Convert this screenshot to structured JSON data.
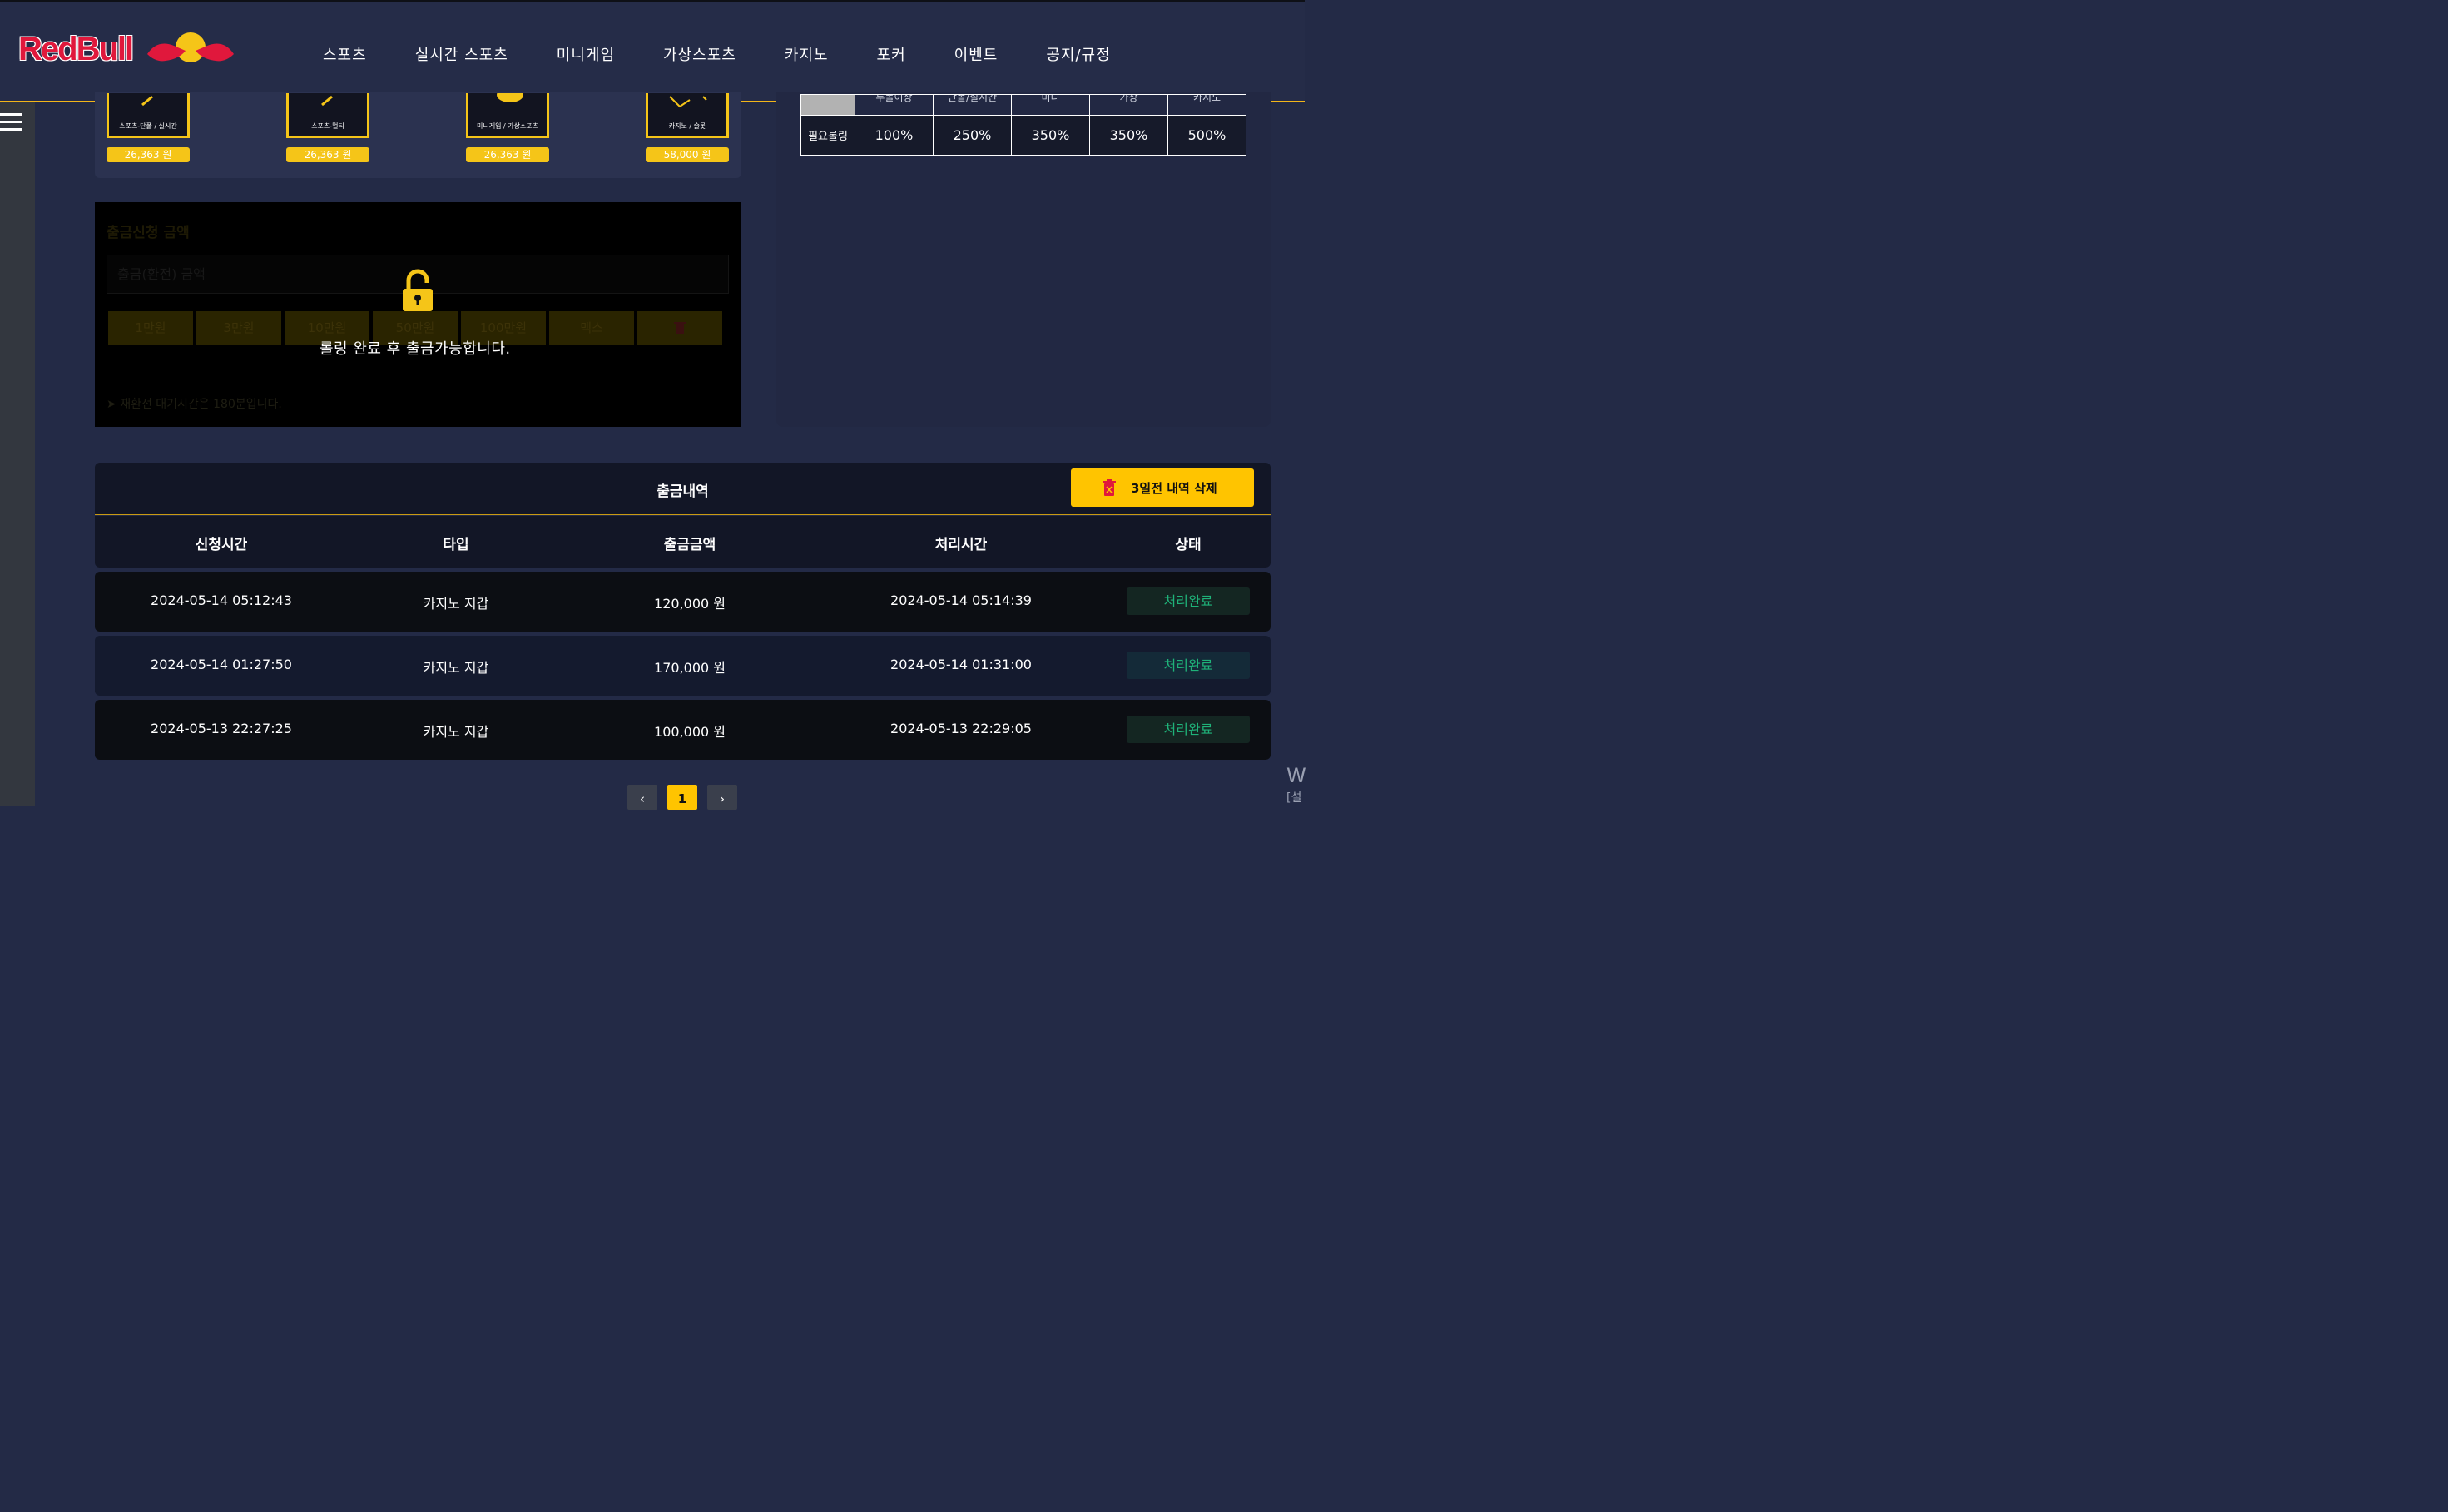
{
  "header": {
    "logo_text": "RedBull",
    "nav": [
      "스포츠",
      "실시간 스포츠",
      "미니게임",
      "가상스포츠",
      "카지노",
      "포커",
      "이벤트",
      "공지/규정"
    ]
  },
  "wallets": [
    {
      "label": "스포츠-단폴 / 실시간",
      "amount": "26,363 원"
    },
    {
      "label": "스포츠-멀티",
      "amount": "26,363 원"
    },
    {
      "label": "미니게임 / 가상스포츠",
      "amount": "26,363 원"
    },
    {
      "label": "카지노 / 슬롯",
      "amount": "58,000 원"
    }
  ],
  "rolling_table": {
    "headers": [
      "",
      "두폴이상",
      "단폴/실시간",
      "미니",
      "가상",
      "카지노"
    ],
    "row_label": "필요롤링",
    "values": [
      "100%",
      "250%",
      "350%",
      "350%",
      "500%"
    ]
  },
  "withdraw": {
    "title": "출금신청 금액",
    "placeholder": "출금(환전) 금액",
    "quick_buttons": [
      "1만원",
      "3만원",
      "10만원",
      "50만원",
      "100만원",
      "맥스",
      ""
    ],
    "note": "재환전 대기시간은 180분입니다.",
    "lock_message": "롤링 완료 후 출금가능합니다."
  },
  "history": {
    "title": "출금내역",
    "delete_label": "3일전 내역 삭제",
    "columns": [
      "신청시간",
      "타입",
      "출금금액",
      "처리시간",
      "상태"
    ],
    "rows": [
      {
        "requested": "2024-05-14 05:12:43",
        "type": "카지노 지갑",
        "amount": "120,000 원",
        "processed": "2024-05-14 05:14:39",
        "status": "처리완료"
      },
      {
        "requested": "2024-05-14 01:27:50",
        "type": "카지노 지갑",
        "amount": "170,000 원",
        "processed": "2024-05-14 01:31:00",
        "status": "처리완료"
      },
      {
        "requested": "2024-05-13 22:27:25",
        "type": "카지노 지갑",
        "amount": "100,000 원",
        "processed": "2024-05-13 22:29:05",
        "status": "처리완료"
      }
    ]
  },
  "pagination": {
    "prev": "‹",
    "current": "1",
    "next": "›"
  },
  "corner": {
    "line1": "W",
    "line2": "[설"
  },
  "colors": {
    "accent": "#ffc400",
    "status_green": "#1fb279",
    "bg": "#232a46",
    "brand_red": "#e0183c"
  }
}
